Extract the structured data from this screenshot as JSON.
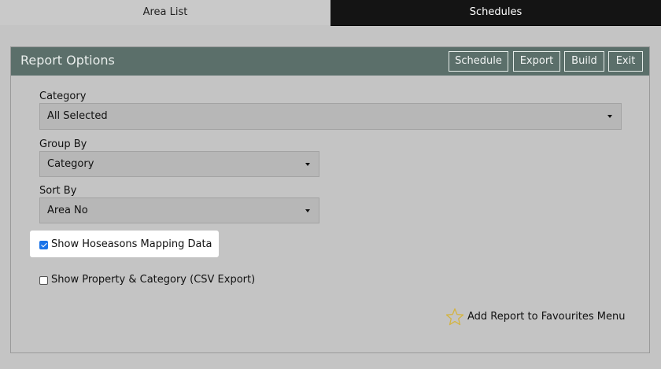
{
  "tabs": [
    {
      "label": "Area List"
    },
    {
      "label": "Schedules"
    }
  ],
  "panel": {
    "title": "Report Options",
    "buttons": {
      "schedule": "Schedule",
      "export": "Export",
      "build": "Build",
      "exit": "Exit"
    }
  },
  "fields": {
    "category": {
      "label": "Category",
      "value": "All Selected"
    },
    "group_by": {
      "label": "Group By",
      "value": "Category"
    },
    "sort_by": {
      "label": "Sort By",
      "value": "Area No"
    }
  },
  "options": {
    "hoseasons_mapping": {
      "label": "Show Hoseasons Mapping Data",
      "checked": true
    },
    "property_category": {
      "label": "Show Property & Category (CSV Export)",
      "checked": false
    }
  },
  "favourites": {
    "label": "Add Report to Favourites Menu",
    "icon": "star-icon"
  },
  "colors": {
    "header_bg": "#5b6f6a",
    "active_tab_bg": "#141414",
    "star": "#d4b441",
    "checkbox_accent": "#1a73e8"
  }
}
